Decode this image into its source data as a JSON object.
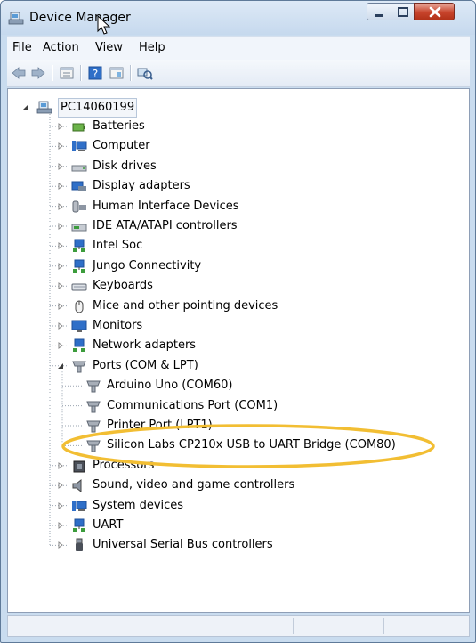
{
  "window": {
    "title": "Device Manager",
    "controls": {
      "minimize": "minimize",
      "maximize": "maximize",
      "close": "close"
    }
  },
  "menu": [
    "File",
    "Action",
    "View",
    "Help"
  ],
  "toolbar": {
    "buttons": [
      "back-arrow-icon",
      "forward-arrow-icon",
      "properties-icon",
      "help-icon",
      "update-driver-icon",
      "scan-hardware-icon"
    ]
  },
  "tree": {
    "root": "PC14060199",
    "categories": [
      {
        "label": "Batteries",
        "icon": "battery-icon"
      },
      {
        "label": "Computer",
        "icon": "computer-icon"
      },
      {
        "label": "Disk drives",
        "icon": "disk-drive-icon"
      },
      {
        "label": "Display adapters",
        "icon": "display-adapter-icon"
      },
      {
        "label": "Human Interface Devices",
        "icon": "hid-icon"
      },
      {
        "label": "IDE ATA/ATAPI controllers",
        "icon": "ide-controller-icon"
      },
      {
        "label": "Intel Soc",
        "icon": "network-device-icon"
      },
      {
        "label": "Jungo Connectivity",
        "icon": "network-device-icon"
      },
      {
        "label": "Keyboards",
        "icon": "keyboard-icon"
      },
      {
        "label": "Mice and other pointing devices",
        "icon": "mouse-icon"
      },
      {
        "label": "Monitors",
        "icon": "monitor-icon"
      },
      {
        "label": "Network adapters",
        "icon": "network-adapter-icon"
      },
      {
        "label": "Ports (COM & LPT)",
        "icon": "port-icon"
      },
      {
        "label": "Processors",
        "icon": "processor-icon"
      },
      {
        "label": "Sound, video and game controllers",
        "icon": "sound-icon"
      },
      {
        "label": "System devices",
        "icon": "system-device-icon"
      },
      {
        "label": "UART",
        "icon": "network-device-icon"
      },
      {
        "label": "Universal Serial Bus controllers",
        "icon": "usb-icon"
      }
    ],
    "ports_children": [
      "Arduino Uno (COM60)",
      "Communications Port (COM1)",
      "Printer Port (LPT1)",
      "Silicon Labs CP210x USB to UART Bridge (COM80)"
    ]
  },
  "colors": {
    "window_frame": "#c9dcef",
    "highlight_ellipse": "#f2be33",
    "close_button": "#c7432b"
  }
}
